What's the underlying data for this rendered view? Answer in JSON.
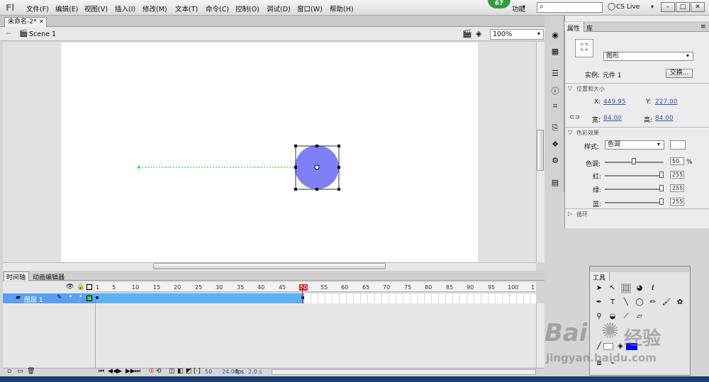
{
  "menubar": {
    "items": [
      "文件(F)",
      "编辑(E)",
      "视图(V)",
      "插入(I)",
      "修改(M)",
      "文本(T)",
      "命令(C)",
      "控制(O)",
      "调试(D)",
      "窗口(W)",
      "帮助(H)"
    ],
    "badge": "67",
    "workspace": "功能",
    "cslive": "CS Live"
  },
  "document": {
    "tab": "未命名-2*",
    "scene": "Scene 1",
    "zoom": "100%"
  },
  "timeline": {
    "tab_timeline": "时间轴",
    "tab_motion": "动画编辑器",
    "ruler": [
      "1",
      "5",
      "10",
      "15",
      "20",
      "25",
      "30",
      "35",
      "40",
      "45",
      "50",
      "55",
      "60",
      "65",
      "70",
      "75",
      "80",
      "85",
      "90",
      "95",
      "100",
      "1"
    ],
    "layer": "图层 1",
    "frame": "50",
    "fps": "24.00",
    "fps_unit": "fps",
    "time": "2.0 s"
  },
  "properties": {
    "tab_props": "属性",
    "tab_lib": "库",
    "type": "图形",
    "instance_label": "实例:",
    "instance_value": "元件 1",
    "swap": "交换...",
    "pos_section": "位置和大小",
    "x_label": "X:",
    "x_value": "449.95",
    "y_label": "Y:",
    "y_value": "227.00",
    "w_label": "宽:",
    "w_value": "84.00",
    "h_label": "高:",
    "h_value": "84.00",
    "color_section": "色彩效果",
    "style_label": "样式:",
    "style_value": "色调",
    "tint_label": "色调:",
    "tint_value": "50",
    "tint_unit": "%",
    "red_label": "红:",
    "red_value": "255",
    "green_label": "绿:",
    "green_value": "255",
    "blue_label": "蓝:",
    "blue_value": "255",
    "loop_section": "循环"
  },
  "tools": {
    "title": "工具"
  },
  "watermark": {
    "line1": "Bai",
    "line2": "经验",
    "line3": "jingyan.baidu.com"
  },
  "colors": {
    "shape_fill": "#7f7ff7",
    "guide": "#33dd33",
    "layer_sel": "#5b9ff2",
    "fill_swatch": "#0000ff",
    "playhead": "#d22222"
  }
}
